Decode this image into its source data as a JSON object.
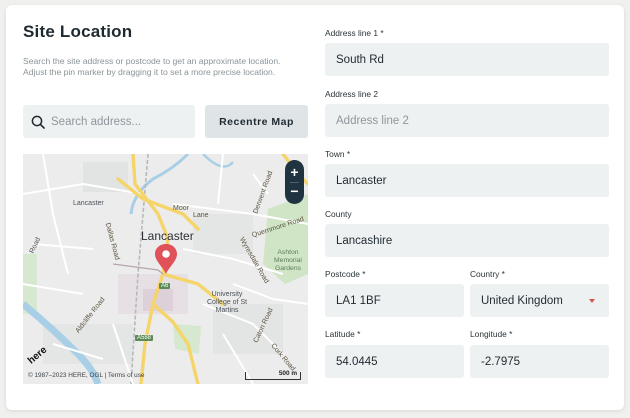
{
  "title": "Site Location",
  "description": "Search the site address or postcode to get an approximate location. Adjust the pin marker by dragging it to set a more precise location.",
  "search": {
    "placeholder": "Search address..."
  },
  "recentre_label": "Recentre Map",
  "map": {
    "city_label": "Lancaster",
    "zoom_in": "+",
    "zoom_out": "−",
    "attribution": "© 1987–2023 HERE, OGL | Terms of use",
    "scale_label": "500 m",
    "logo_text": "here",
    "labels": {
      "lancaster_small": "Lancaster",
      "moor": "Moor",
      "lane": "Lane",
      "quernmore": "Quernmore Road",
      "derwent": "Derwent Road",
      "dallas": "Dallas Road",
      "wyresdale": "Wyresdale Road",
      "ashton": "Ashton\nMemorial\nGardens",
      "university": "University\nCollege of St\nMartins",
      "aldcliffe": "Aldcliffe Road",
      "caton": "Caton Road",
      "a6": "A6",
      "a588": "A588",
      "road_left": "Road",
      "coulston": "Coulston Road",
      "cork": "Cork Road",
      "bowerham": "Bowerham"
    }
  },
  "form": {
    "address1": {
      "label": "Address line 1 *",
      "value": "South Rd",
      "placeholder": ""
    },
    "address2": {
      "label": "Address line 2",
      "value": "",
      "placeholder": "Address line 2"
    },
    "town": {
      "label": "Town *",
      "value": "Lancaster"
    },
    "county": {
      "label": "County",
      "value": "Lancashire"
    },
    "postcode": {
      "label": "Postcode *",
      "value": "LA1 1BF"
    },
    "country": {
      "label": "Country *",
      "value": "United Kingdom"
    },
    "latitude": {
      "label": "Latitude *",
      "value": "54.0445"
    },
    "longitude": {
      "label": "Longitude *",
      "value": "-2.7975"
    }
  },
  "colors": {
    "pin": "#e0515a",
    "zoom_bg": "#1f3440",
    "field_bg": "#eef1f2",
    "road_yellow": "#f5d469",
    "river": "#a9cfe6",
    "park": "#cfe5c6"
  }
}
